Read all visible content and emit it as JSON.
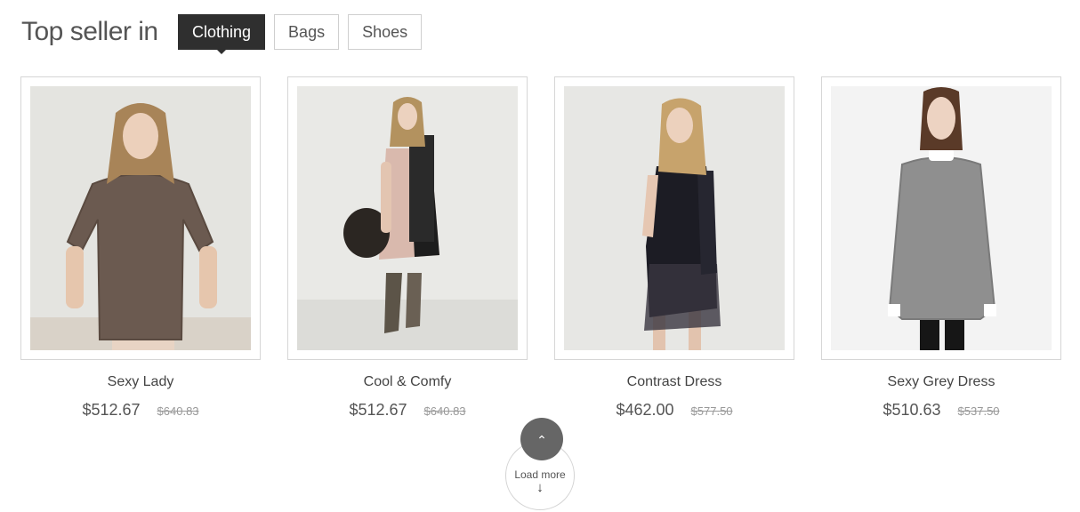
{
  "section": {
    "heading": "Top seller in",
    "tabs": [
      {
        "label": "Clothing",
        "active": true
      },
      {
        "label": "Bags",
        "active": false
      },
      {
        "label": "Shoes",
        "active": false
      }
    ]
  },
  "products": [
    {
      "name": "Sexy Lady",
      "price": "$512.67",
      "old_price": "$640.83"
    },
    {
      "name": "Cool & Comfy",
      "price": "$512.67",
      "old_price": "$640.83"
    },
    {
      "name": "Contrast Dress",
      "price": "$462.00",
      "old_price": "$577.50"
    },
    {
      "name": "Sexy Grey Dress",
      "price": "$510.63",
      "old_price": "$537.50"
    }
  ],
  "controls": {
    "scroll_up_icon": "chevron-up-icon",
    "load_more_label": "Load more",
    "load_more_icon": "arrow-down-icon"
  },
  "colors": {
    "active_tab": "#2f2f2f",
    "up_button": "#666666"
  }
}
